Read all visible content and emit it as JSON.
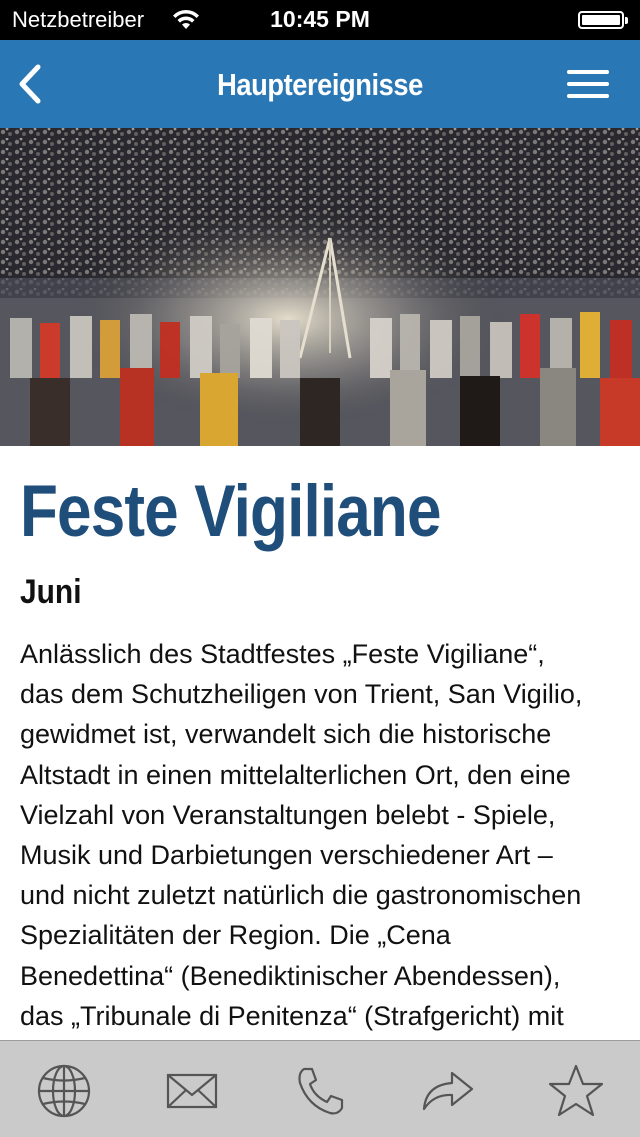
{
  "status_bar": {
    "carrier": "Netzbetreiber",
    "time": "10:45 PM",
    "icons": [
      "wifi-icon",
      "battery-icon"
    ]
  },
  "nav": {
    "title": "Haupterei­gnisse",
    "back_icon": "chevron-left-icon",
    "menu_icon": "hamburger-menu-icon"
  },
  "hero": {
    "description_icon": "photo"
  },
  "article": {
    "title": "Feste Vigiliane",
    "date": "Juni",
    "lines": [
      "Anlässlich des Stadtfestes „Feste Vigiliane“,",
      "das dem Schutzheiligen von Trient, San Vigilio,",
      "gewidmet ist, verwandelt sich die historische",
      "Altstadt in einen mittelalterlichen Ort, den eine",
      "Vielzahl von Veranstaltungen belebt - Spiele,",
      "Musik und Darbietungen verschiedener Art –",
      "und nicht zuletzt natürlich die gastronomischen",
      "Spezialitäten der Region. Die „Cena",
      "Benedettina“ (Benediktinischer Abendessen),",
      "das „Tribunale di Penitenza“ (Strafgericht) mit"
    ]
  },
  "toolbar": {
    "buttons": [
      "globe-icon",
      "mail-icon",
      "phone-icon",
      "share-icon",
      "star-icon"
    ]
  },
  "colors": {
    "nav_background": "#2a77b5",
    "title_color": "#1f4e7a",
    "toolbar_background": "#cacaca",
    "toolbar_icon": "#555555"
  }
}
